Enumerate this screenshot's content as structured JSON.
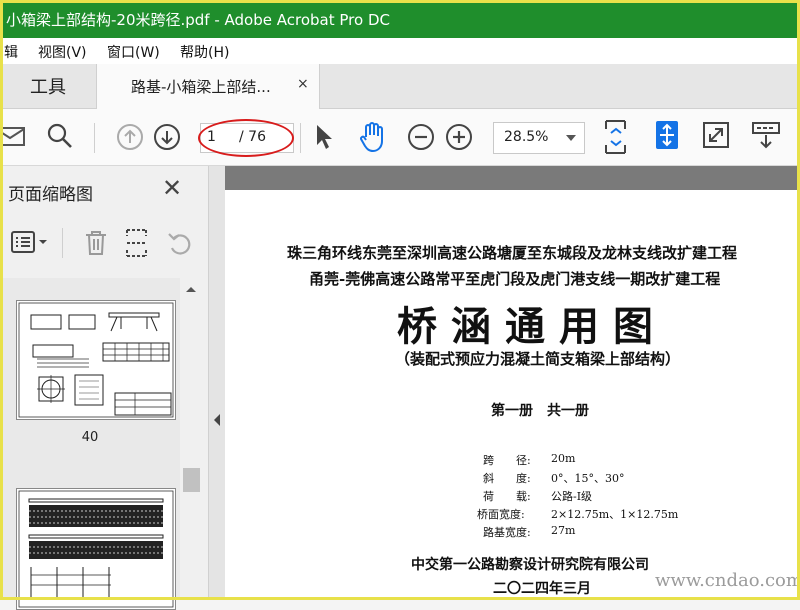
{
  "window": {
    "title": "小箱梁上部结构-20米跨径.pdf - Adobe Acrobat Pro DC"
  },
  "menu": {
    "items": [
      "辑",
      "视图(V)",
      "窗口(W)",
      "帮助(H)"
    ]
  },
  "tabs": {
    "tools_label": "工具",
    "document_label": "路基-小箱梁上部结...",
    "close_glyph": "×"
  },
  "toolbar": {
    "page_current": "1",
    "page_total": "/ 76",
    "zoom": "28.5%",
    "icons": [
      "mail-icon",
      "search-icon",
      "prev-page-icon",
      "next-page-icon",
      "select-cursor-icon",
      "hand-tool-icon",
      "zoom-out-icon",
      "zoom-in-icon",
      "fit-page-icon",
      "scroll-mode-icon",
      "full-screen-icon",
      "read-mode-icon"
    ],
    "annotation_color": "#d81c1c"
  },
  "sidebar": {
    "title": "页面缩略图",
    "close_glyph": "✕",
    "thumbnails": [
      {
        "label": "40"
      }
    ]
  },
  "document": {
    "line1": "珠三角环线东莞至深圳高速公路塘厦至东城段及龙林支线改扩建工程",
    "line2": "甬莞-莞佛高速公路常平至虎门段及虎门港支线一期改扩建工程",
    "title": "桥涵通用图",
    "subtitle": "（装配式预应力混凝土简支箱梁上部结构）",
    "volume": "第一册　共一册",
    "specs": [
      {
        "key": "跨　　径:",
        "value": "20m"
      },
      {
        "key": "斜　　度:",
        "value": "0°、15°、30°"
      },
      {
        "key": "荷　　载:",
        "value": "公路-Ⅰ级"
      },
      {
        "key": "桥面宽度:",
        "value": "2×12.75m、1×12.75m"
      },
      {
        "key": "路基宽度:",
        "value": "27m"
      }
    ],
    "organization": "中交第一公路勘察设计研究院有限公司",
    "date": "二〇二四年三月"
  },
  "watermark": "www.cndao.com",
  "colors": {
    "titlebar": "#1f8e2c",
    "frame": "#e8e14a",
    "accent_blue": "#1473e6"
  }
}
